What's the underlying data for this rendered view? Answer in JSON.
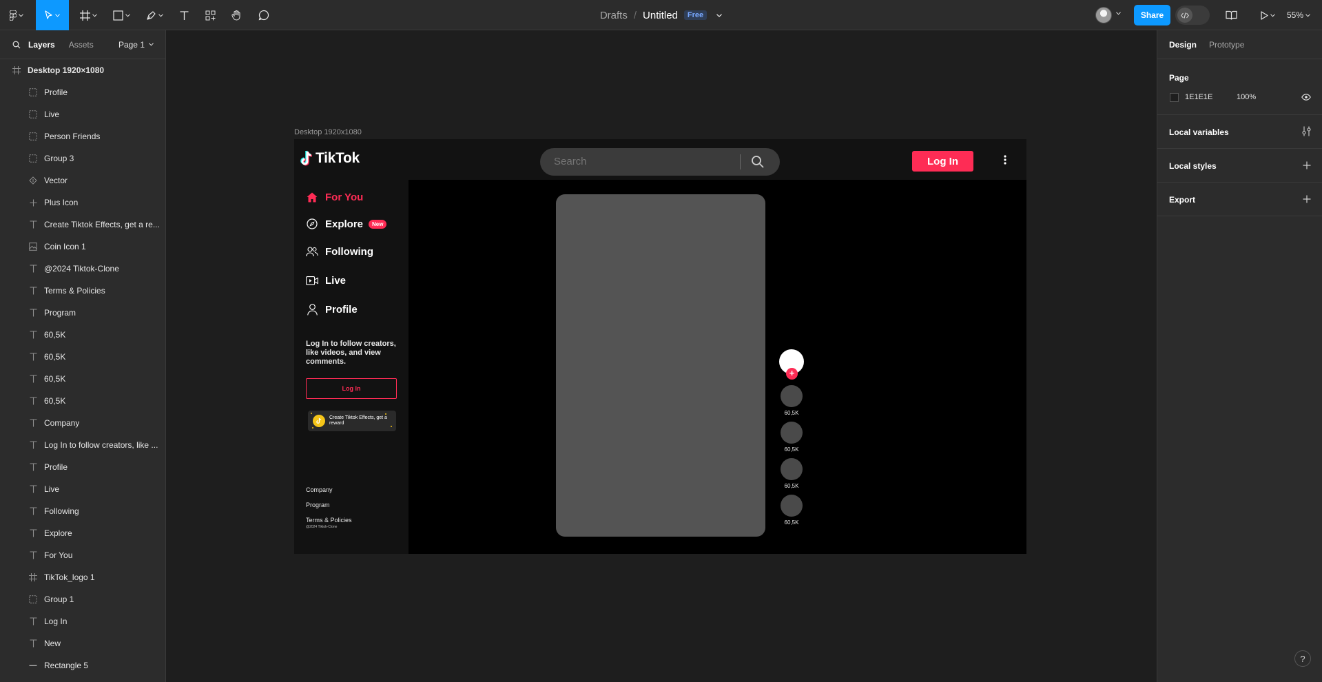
{
  "toolbar": {
    "breadcrumb": "Drafts",
    "separator": "/",
    "title": "Untitled",
    "plan_badge": "Free",
    "share_label": "Share",
    "zoom": "55%"
  },
  "layers_panel": {
    "tabs": [
      "Layers",
      "Assets"
    ],
    "page_selector": "Page 1",
    "root": {
      "name": "Desktop 1920×1080",
      "icon": "frame-icon"
    },
    "items": [
      {
        "name": "Profile",
        "icon": "group-icon"
      },
      {
        "name": "Live",
        "icon": "group-icon"
      },
      {
        "name": "Person Friends",
        "icon": "group-icon"
      },
      {
        "name": "Group 3",
        "icon": "group-icon"
      },
      {
        "name": "Vector",
        "icon": "vector-icon"
      },
      {
        "name": "Plus Icon",
        "icon": "plus-icon"
      },
      {
        "name": "Create Tiktok Effects, get a re...",
        "icon": "text-icon"
      },
      {
        "name": "Coin Icon 1",
        "icon": "image-icon"
      },
      {
        "name": "@2024 Tiktok-Clone",
        "icon": "text-icon"
      },
      {
        "name": "Terms & Policies",
        "icon": "text-icon"
      },
      {
        "name": "Program",
        "icon": "text-icon"
      },
      {
        "name": "60,5K",
        "icon": "text-icon"
      },
      {
        "name": "60,5K",
        "icon": "text-icon"
      },
      {
        "name": "60,5K",
        "icon": "text-icon"
      },
      {
        "name": "60,5K",
        "icon": "text-icon"
      },
      {
        "name": "Company",
        "icon": "text-icon"
      },
      {
        "name": "Log In to follow creators, like ...",
        "icon": "text-icon"
      },
      {
        "name": "Profile",
        "icon": "text-icon"
      },
      {
        "name": "Live",
        "icon": "text-icon"
      },
      {
        "name": "Following",
        "icon": "text-icon"
      },
      {
        "name": "Explore",
        "icon": "text-icon"
      },
      {
        "name": "For You",
        "icon": "text-icon"
      },
      {
        "name": "TikTok_logo 1",
        "icon": "frame-icon"
      },
      {
        "name": "Group 1",
        "icon": "group-icon"
      },
      {
        "name": "Log In",
        "icon": "text-icon"
      },
      {
        "name": "New",
        "icon": "text-icon"
      },
      {
        "name": "Rectangle 5",
        "icon": "rectangle-icon"
      }
    ]
  },
  "design_panel": {
    "tabs": [
      "Design",
      "Prototype"
    ],
    "page_heading": "Page",
    "page_color": "1E1E1E",
    "page_opacity": "100%",
    "sections": [
      "Local variables",
      "Local styles",
      "Export"
    ],
    "help": "?"
  },
  "canvas": {
    "frame_label": "Desktop 1920x1080"
  },
  "tiktok": {
    "logo_text": "TikTok",
    "search_placeholder": "Search",
    "login_label": "Log In",
    "nav": [
      {
        "label": "For You",
        "icon": "home-icon",
        "active": true
      },
      {
        "label": "Explore",
        "icon": "compass-icon",
        "badge": "New"
      },
      {
        "label": "Following",
        "icon": "people-icon"
      },
      {
        "label": "Live",
        "icon": "live-icon"
      },
      {
        "label": "Profile",
        "icon": "person-icon"
      }
    ],
    "login_prompt": "Log In to follow creators, like videos, and view comments.",
    "side_login_label": "Log In",
    "effects_text": "Create Tiktok Effects, get a reward",
    "footer_links": [
      "Company",
      "Program",
      "Terms & Policies"
    ],
    "copyright": "@2024 Tiktok-Clone",
    "action_counts": [
      "60,5K",
      "60,5K",
      "60,5K",
      "60,5K"
    ],
    "follow_plus": "+"
  },
  "colors": {
    "accent_blue": "#0d99ff",
    "tiktok_red": "#fe2c55",
    "panel_bg": "#2c2c2c",
    "canvas_bg": "#1e1e1e"
  }
}
